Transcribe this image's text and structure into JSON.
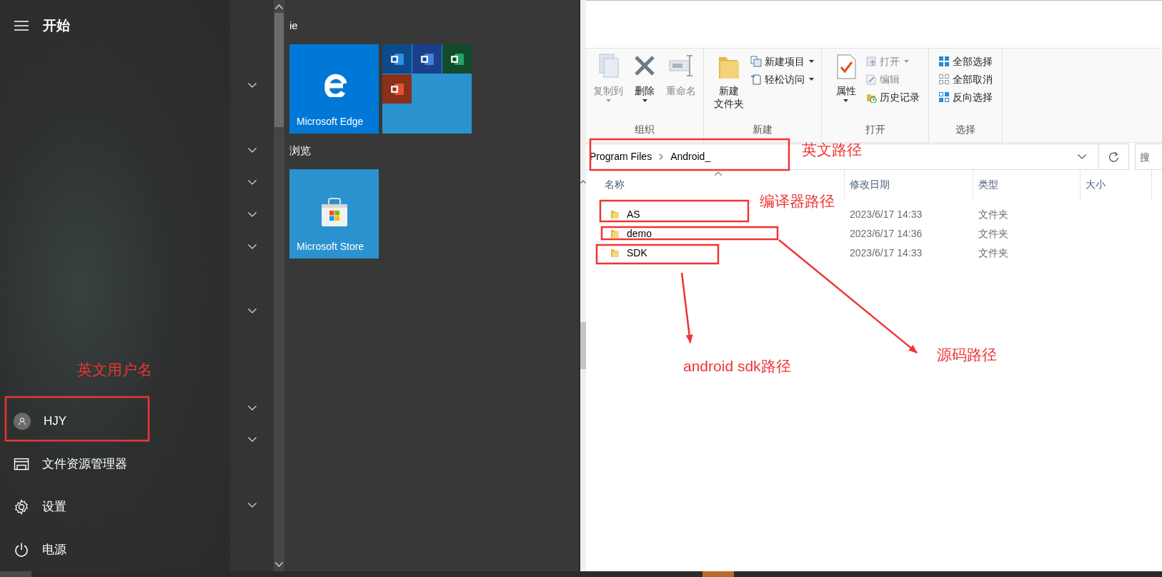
{
  "start_menu": {
    "title": "开始",
    "tile_groups": [
      {
        "title": "ie",
        "tiles": [
          {
            "kind": "edge",
            "label": "Microsoft Edge"
          },
          {
            "kind": "office-folder"
          }
        ]
      },
      {
        "title": "浏览",
        "tiles": [
          {
            "kind": "store",
            "label": "Microsoft Store"
          }
        ]
      }
    ],
    "user": {
      "name": "HJY"
    },
    "items": [
      {
        "kind": "explorer",
        "label": "文件资源管理器"
      },
      {
        "kind": "settings",
        "label": "设置"
      },
      {
        "kind": "power",
        "label": "电源"
      }
    ]
  },
  "explorer": {
    "ribbon": [
      {
        "label": "组织",
        "commands": [
          {
            "kind": "large",
            "label": "复制到",
            "disabled": true,
            "dropdown": true
          },
          {
            "kind": "large",
            "label": "删除",
            "disabled": false,
            "dropdown": true
          },
          {
            "kind": "large",
            "label": "重命名",
            "disabled": true,
            "dropdown": false
          }
        ]
      },
      {
        "label": "新建",
        "commands": [
          {
            "kind": "large",
            "label_lines": [
              "新建",
              "文件夹"
            ],
            "disabled": false,
            "dropdown": false
          },
          {
            "kind": "small",
            "label": "新建项目",
            "disabled": false,
            "dropdown": true
          },
          {
            "kind": "small",
            "label": "轻松访问",
            "disabled": false,
            "dropdown": true
          }
        ]
      },
      {
        "label": "打开",
        "commands": [
          {
            "kind": "large",
            "label": "属性",
            "disabled": false,
            "dropdown": true
          },
          {
            "kind": "small",
            "label": "打开",
            "disabled": true,
            "dropdown": true
          },
          {
            "kind": "small",
            "label": "编辑",
            "disabled": true,
            "dropdown": false
          },
          {
            "kind": "small",
            "label": "历史记录",
            "disabled": false,
            "dropdown": false
          }
        ]
      },
      {
        "label": "选择",
        "commands": [
          {
            "kind": "small",
            "label": "全部选择",
            "disabled": false,
            "dropdown": false
          },
          {
            "kind": "small",
            "label": "全部取消",
            "disabled": false,
            "dropdown": false
          },
          {
            "kind": "small",
            "label": "反向选择",
            "disabled": false,
            "dropdown": false
          }
        ]
      }
    ],
    "breadcrumbs": [
      "Program Files",
      "Android_"
    ],
    "search": {
      "placeholder": "搜"
    },
    "columns": [
      "名称",
      "修改日期",
      "类型",
      "大小"
    ],
    "rows": [
      {
        "name": "AS",
        "modified": "2023/6/17 14:33",
        "type": "文件夹"
      },
      {
        "name": "demo",
        "modified": "2023/6/17 14:36",
        "type": "文件夹"
      },
      {
        "name": "SDK",
        "modified": "2023/6/17 14:33",
        "type": "文件夹"
      }
    ]
  },
  "annotations": [
    "英文用户名",
    "英文路径",
    "编译器路径",
    "android sdk路径",
    "源码路径"
  ]
}
